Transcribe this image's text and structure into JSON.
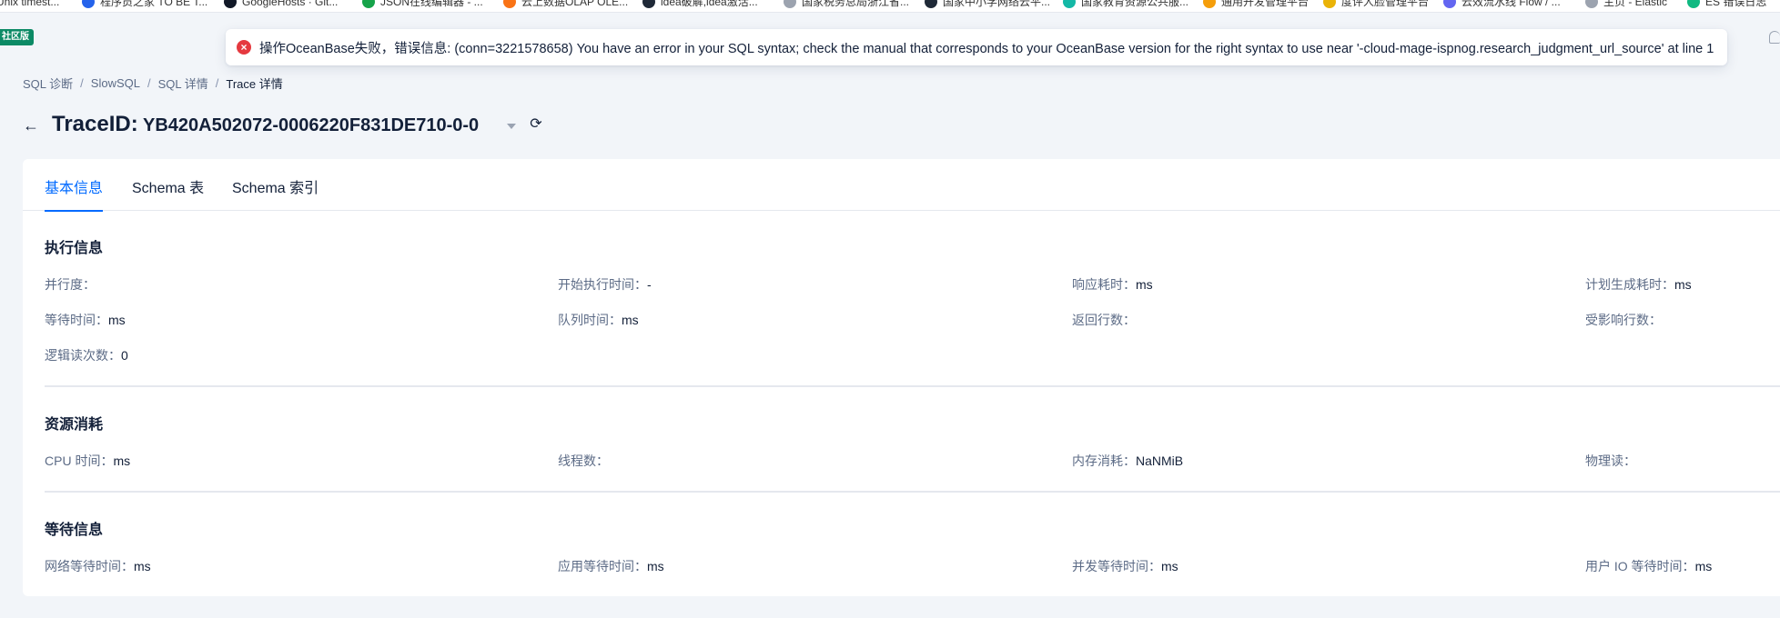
{
  "colors": {
    "accent": "#006aff",
    "error": "#e5393f",
    "badge": "#0c8a65"
  },
  "bookmarks": [
    {
      "label": "Unix timest...",
      "icon": "page-icon",
      "color": "#6b7280"
    },
    {
      "label": "程序员之家 TO BE T...",
      "icon": "blue-globe-icon",
      "color": "#2563eb"
    },
    {
      "label": "GoogleHosts · Git...",
      "icon": "github-icon",
      "color": "#111827"
    },
    {
      "label": "JSON在线编辑器 - ...",
      "icon": "json-icon",
      "color": "#16a34a"
    },
    {
      "label": "云上数据OLAP OLE...",
      "icon": "cloud-icon",
      "color": "#f97316"
    },
    {
      "label": "idea破解,idea激活...",
      "icon": "page-icon",
      "color": "#1f2937"
    },
    {
      "label": "国家税务总局浙江省...",
      "icon": "tax-icon",
      "color": "#9ca3af"
    },
    {
      "label": "国家中小学网络云平...",
      "icon": "page-icon",
      "color": "#1f2937"
    },
    {
      "label": "国家教育资源公共服...",
      "icon": "edu-icon",
      "color": "#14b8a6"
    },
    {
      "label": "通用开发管理平台",
      "icon": "avatar-icon",
      "color": "#f59e0b"
    },
    {
      "label": "度评人脸管理平台",
      "icon": "avatar-icon",
      "color": "#eab308"
    },
    {
      "label": "云效流水线 Flow / ...",
      "icon": "flow-icon",
      "color": "#6366f1"
    },
    {
      "label": "主页 - Elastic",
      "icon": "elastic-icon",
      "color": "#9ca3af"
    },
    {
      "label": "ES 错误日志",
      "icon": "es-icon",
      "color": "#10b981"
    }
  ],
  "edition_badge": "社区版",
  "toast": {
    "icon": "error-circle-icon",
    "message": "操作OceanBase失败，错误信息: (conn=3221578658) You have an error in your SQL syntax; check the manual that corresponds to your OceanBase version for the right syntax to use near '-cloud-mage-ispnog.research_judgment_url_source' at line 1"
  },
  "breadcrumb": {
    "items": [
      "SQL 诊断",
      "SlowSQL",
      "SQL 详情",
      "Trace 详情"
    ],
    "separator": "/"
  },
  "header": {
    "title_label": "TraceID:",
    "trace_id": "YB420A502072-0006220F831DE710-0-0"
  },
  "tabs": [
    {
      "label": "基本信息",
      "active": true
    },
    {
      "label": "Schema 表",
      "active": false
    },
    {
      "label": "Schema 索引",
      "active": false
    }
  ],
  "sections": {
    "exec": {
      "title": "执行信息",
      "fields": [
        {
          "label": "并行度：",
          "value": ""
        },
        {
          "label": "开始执行时间：",
          "value": "-"
        },
        {
          "label": "响应耗时：",
          "value": "ms"
        },
        {
          "label": "计划生成耗时：",
          "value": "ms"
        },
        {
          "label": "等待时间：",
          "value": "ms"
        },
        {
          "label": "队列时间：",
          "value": "ms"
        },
        {
          "label": "返回行数：",
          "value": ""
        },
        {
          "label": "受影响行数：",
          "value": ""
        },
        {
          "label": "逻辑读次数：",
          "value": "0"
        }
      ]
    },
    "resource": {
      "title": "资源消耗",
      "fields": [
        {
          "label": "CPU 时间：",
          "value": "ms"
        },
        {
          "label": "线程数：",
          "value": ""
        },
        {
          "label": "内存消耗：",
          "value": "NaNMiB"
        },
        {
          "label": "物理读：",
          "value": ""
        }
      ]
    },
    "wait": {
      "title": "等待信息",
      "fields": [
        {
          "label": "网络等待时间：",
          "value": "ms"
        },
        {
          "label": "应用等待时间：",
          "value": "ms"
        },
        {
          "label": "并发等待时间：",
          "value": "ms"
        },
        {
          "label": "用户 IO 等待时间：",
          "value": "ms"
        }
      ]
    }
  }
}
